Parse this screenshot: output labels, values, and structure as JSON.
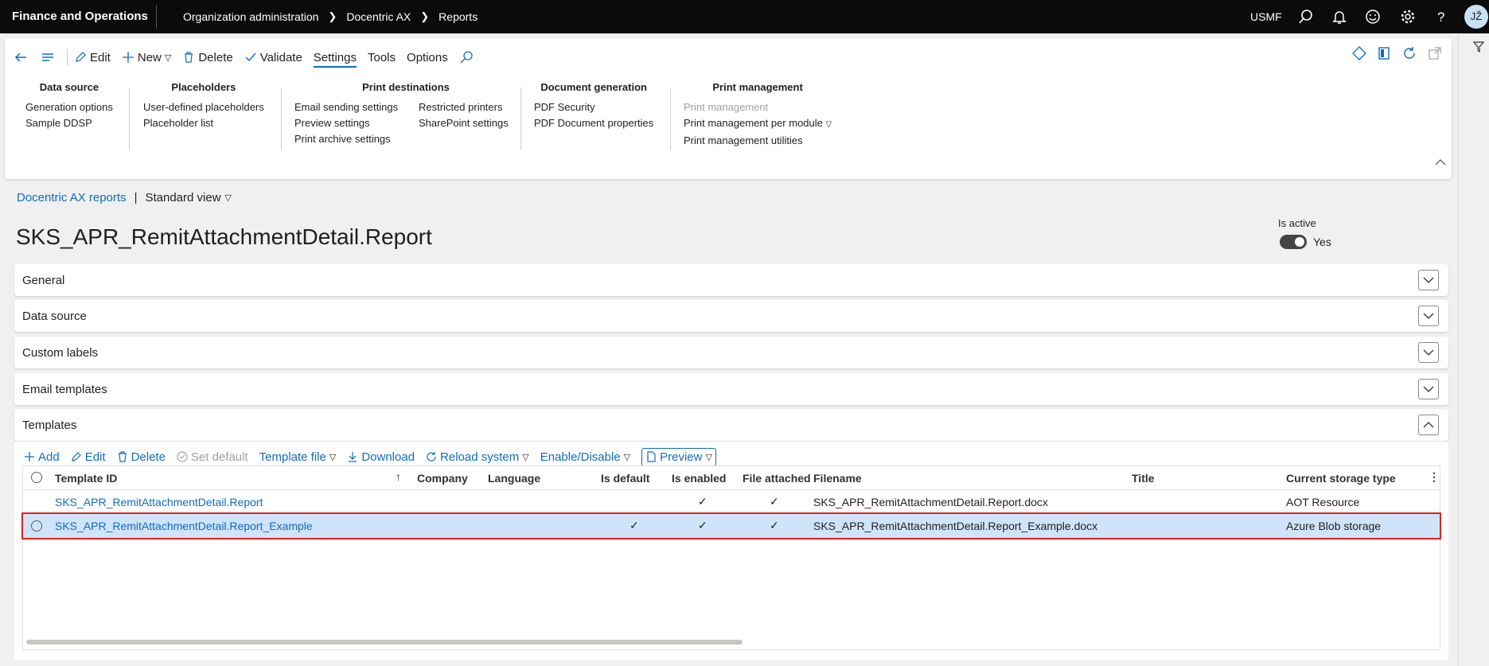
{
  "topbar": {
    "app_name": "Finance and Operations",
    "breadcrumbs": [
      "Organization administration",
      "Docentric AX",
      "Reports"
    ],
    "company": "USMF",
    "avatar_initials": "JŽ",
    "icons": [
      "search-icon",
      "bell-icon",
      "smiley-icon",
      "gear-icon",
      "help-icon"
    ]
  },
  "actionbar": {
    "edit": "Edit",
    "new": "New",
    "delete": "Delete",
    "validate": "Validate",
    "settings": "Settings",
    "tools": "Tools",
    "options": "Options"
  },
  "ribbon": {
    "data_source": {
      "title": "Data source",
      "items": [
        "Generation options",
        "Sample DDSP"
      ]
    },
    "placeholders": {
      "title": "Placeholders",
      "items": [
        "User-defined placeholders",
        "Placeholder list"
      ]
    },
    "print_destinations": {
      "title": "Print destinations",
      "col1": [
        "Email sending settings",
        "Preview settings",
        "Print archive settings"
      ],
      "col2": [
        "Restricted printers",
        "SharePoint settings"
      ]
    },
    "document_generation": {
      "title": "Document generation",
      "items": [
        "PDF Security",
        "PDF Document properties"
      ]
    },
    "print_management": {
      "title": "Print management",
      "items": [
        "Print management",
        "Print management per module",
        "Print management utilities"
      ]
    }
  },
  "page": {
    "breadcrumb_link": "Docentric AX reports",
    "view": "Standard view",
    "title": "SKS_APR_RemitAttachmentDetail.Report",
    "is_active_label": "Is active",
    "is_active_value": "Yes"
  },
  "sections": [
    "General",
    "Data source",
    "Custom labels",
    "Email templates",
    "Templates"
  ],
  "gridbar": {
    "add": "Add",
    "edit": "Edit",
    "delete": "Delete",
    "set_default": "Set default",
    "template_file": "Template file",
    "download": "Download",
    "reload_system": "Reload system",
    "enable_disable": "Enable/Disable",
    "preview": "Preview"
  },
  "grid": {
    "columns": [
      "Template ID",
      "Company",
      "Language",
      "Is default",
      "Is enabled",
      "File attached",
      "Filename",
      "Title",
      "Current storage type"
    ],
    "rows": [
      {
        "template_id": "SKS_APR_RemitAttachmentDetail.Report",
        "company": "",
        "language": "",
        "is_default": "",
        "is_enabled": "✓",
        "file_attached": "✓",
        "filename": "SKS_APR_RemitAttachmentDetail.Report.docx",
        "title": "",
        "storage": "AOT Resource"
      },
      {
        "template_id": "SKS_APR_RemitAttachmentDetail.Report_Example",
        "company": "",
        "language": "",
        "is_default": "✓",
        "is_enabled": "✓",
        "file_attached": "✓",
        "filename": "SKS_APR_RemitAttachmentDetail.Report_Example.docx",
        "title": "",
        "storage": "Azure Blob storage"
      }
    ]
  }
}
